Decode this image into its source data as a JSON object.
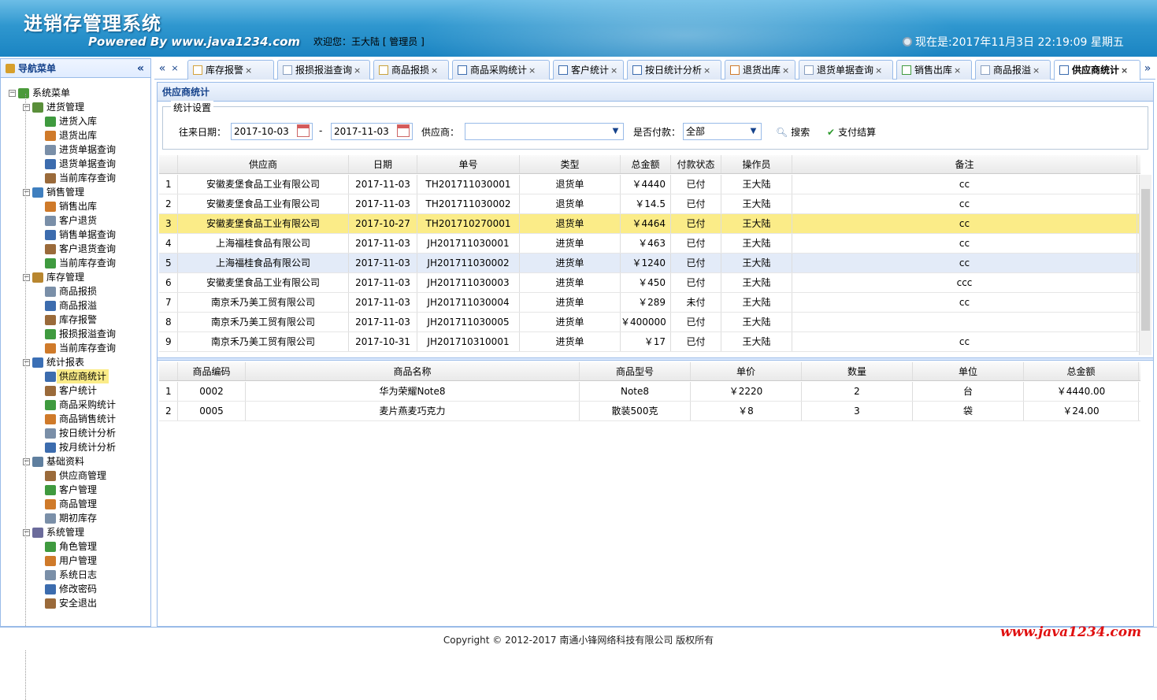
{
  "header": {
    "app_title": "进销存管理系统",
    "powered_by": "Powered By www.java1234.com",
    "welcome": "欢迎您：王大陆 [ 管理员 ]",
    "clock": "现在是:2017年11月3日 22:19:09 星期五"
  },
  "nav": {
    "title": "导航菜单",
    "collapse": "«",
    "root": "系统菜单",
    "groups": [
      {
        "label": "进货管理",
        "items": [
          "进货入库",
          "退货出库",
          "进货单据查询",
          "退货单据查询",
          "当前库存查询"
        ]
      },
      {
        "label": "销售管理",
        "items": [
          "销售出库",
          "客户退货",
          "销售单据查询",
          "客户退货查询",
          "当前库存查询"
        ]
      },
      {
        "label": "库存管理",
        "items": [
          "商品报损",
          "商品报溢",
          "库存报警",
          "报损报溢查询",
          "当前库存查询"
        ]
      },
      {
        "label": "统计报表",
        "items": [
          "供应商统计",
          "客户统计",
          "商品采购统计",
          "商品销售统计",
          "按日统计分析",
          "按月统计分析"
        ]
      },
      {
        "label": "基础资料",
        "items": [
          "供应商管理",
          "客户管理",
          "商品管理",
          "期初库存"
        ]
      },
      {
        "label": "系统管理",
        "items": [
          "角色管理",
          "用户管理",
          "系统日志",
          "修改密码",
          "安全退出"
        ]
      }
    ],
    "selected": "供应商统计"
  },
  "tabs": {
    "scroll_left": "«",
    "scroll_right": "»",
    "items": [
      "库存报警",
      "报损报溢查询",
      "商品报损",
      "商品采购统计",
      "客户统计",
      "按日统计分析",
      "退货出库",
      "退货单据查询",
      "销售出库",
      "商品报溢",
      "供应商统计"
    ],
    "active": "供应商统计",
    "close": "×"
  },
  "panel": {
    "title": "供应商统计",
    "filter": {
      "legend": "统计设置",
      "date_label": "往来日期：",
      "date_from": "2017-10-03",
      "date_sep": "-",
      "date_to": "2017-11-03",
      "supplier_label": "供应商：",
      "supplier_value": "",
      "paid_label": "是否付款：",
      "paid_value": "全部",
      "search_button": "搜索",
      "pay_button": "支付结算"
    }
  },
  "orders": {
    "columns": [
      "",
      "供应商",
      "日期",
      "单号",
      "类型",
      "总金额",
      "付款状态",
      "操作员",
      "备注"
    ],
    "rows": [
      [
        "1",
        "安徽麦堡食品工业有限公司",
        "2017-11-03",
        "TH201711030001",
        "退货单",
        "￥4440",
        "已付",
        "王大陆",
        "cc"
      ],
      [
        "2",
        "安徽麦堡食品工业有限公司",
        "2017-11-03",
        "TH201711030002",
        "退货单",
        "￥14.5",
        "已付",
        "王大陆",
        "cc"
      ],
      [
        "3",
        "安徽麦堡食品工业有限公司",
        "2017-10-27",
        "TH201710270001",
        "退货单",
        "￥4464",
        "已付",
        "王大陆",
        "cc"
      ],
      [
        "4",
        "上海福桂食品有限公司",
        "2017-11-03",
        "JH201711030001",
        "进货单",
        "￥463",
        "已付",
        "王大陆",
        "cc"
      ],
      [
        "5",
        "上海福桂食品有限公司",
        "2017-11-03",
        "JH201711030002",
        "进货单",
        "￥1240",
        "已付",
        "王大陆",
        "cc"
      ],
      [
        "6",
        "安徽麦堡食品工业有限公司",
        "2017-11-03",
        "JH201711030003",
        "进货单",
        "￥450",
        "已付",
        "王大陆",
        "ccc"
      ],
      [
        "7",
        "南京禾乃美工贸有限公司",
        "2017-11-03",
        "JH201711030004",
        "进货单",
        "￥289",
        "未付",
        "王大陆",
        "cc"
      ],
      [
        "8",
        "南京禾乃美工贸有限公司",
        "2017-11-03",
        "JH201711030005",
        "进货单",
        "￥400000",
        "已付",
        "王大陆",
        ""
      ],
      [
        "9",
        "南京禾乃美工贸有限公司",
        "2017-10-31",
        "JH201710310001",
        "进货单",
        "￥17",
        "已付",
        "王大陆",
        "cc"
      ]
    ]
  },
  "items": {
    "columns": [
      "",
      "商品编码",
      "商品名称",
      "商品型号",
      "单价",
      "数量",
      "单位",
      "总金额"
    ],
    "rows": [
      [
        "1",
        "0002",
        "华为荣耀Note8",
        "Note8",
        "￥2220",
        "2",
        "台",
        "￥4440.00"
      ],
      [
        "2",
        "0005",
        "麦片燕麦巧克力",
        "散装500克",
        "￥8",
        "3",
        "袋",
        "￥24.00"
      ]
    ]
  },
  "footer": {
    "copyright": "Copyright © 2012-2017 南通小锋网络科技有限公司 版权所有",
    "site": "www.java1234.com"
  },
  "colors": {
    "header": "#2f97cf",
    "border": "#99bbe8",
    "highlight": "#fbec88",
    "site_red": "#e01010"
  }
}
